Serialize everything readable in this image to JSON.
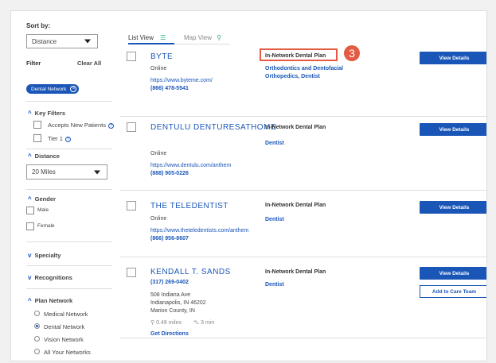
{
  "sidebar": {
    "sort_label": "Sort by:",
    "sort_value": "Distance",
    "filter_label": "Filter",
    "clear_all": "Clear All",
    "active_chip": "Dental Network",
    "key_filters": {
      "title": "Key Filters",
      "items": [
        "Accepts New Patients",
        "Tier 1"
      ]
    },
    "distance": {
      "title": "Distance",
      "value": "20 Miles"
    },
    "gender": {
      "title": "Gender",
      "items": [
        "Male",
        "Female"
      ]
    },
    "specialty_title": "Specialty",
    "recognitions_title": "Recognitions",
    "plan_network": {
      "title": "Plan Network",
      "items": [
        "Medical Network",
        "Dental Network",
        "Vision Network",
        "All Your Networks"
      ],
      "selected": "Dental Network"
    }
  },
  "tabs": {
    "list": "List View",
    "map": "Map View"
  },
  "annotation_number": "3",
  "results": [
    {
      "name": "BYTE",
      "location": "Online",
      "url": "https://www.byteme.com/",
      "phone": "(866) 478-5541",
      "network": "In-Network Dental Plan",
      "specialty": "Orthodontics and Dentofacial Orthopedics, Dentist",
      "button": "View Details"
    },
    {
      "name": "DENTULU DENTURESATHOME",
      "location": "Online",
      "url": "https://www.dentulu.com/anthem",
      "phone": "(888) 905-0226",
      "network": "In-Network Dental Plan",
      "specialty": "Dentist",
      "button": "View Details"
    },
    {
      "name": "THE TELEDENTIST",
      "location": "Online",
      "url": "https://www.theteledentists.com/anthem",
      "phone": "(866) 956-8607",
      "network": "In-Network Dental Plan",
      "specialty": "Dentist",
      "button": "View Details"
    },
    {
      "name": "KENDALL T. SANDS",
      "phone": "(317) 269-0402",
      "address1": "508 Indiana Ave",
      "address2": "Indianapolis, IN 46202",
      "address3": "Marion County, IN",
      "distance": "0.48 miles",
      "drive": "3 min",
      "directions": "Get Directions",
      "network": "In-Network Dental Plan",
      "specialty": "Dentist",
      "button": "View Details",
      "button2": "Add to Care Team"
    }
  ],
  "colors": {
    "accent": "#1a56b8",
    "annotation": "#e35b43"
  }
}
